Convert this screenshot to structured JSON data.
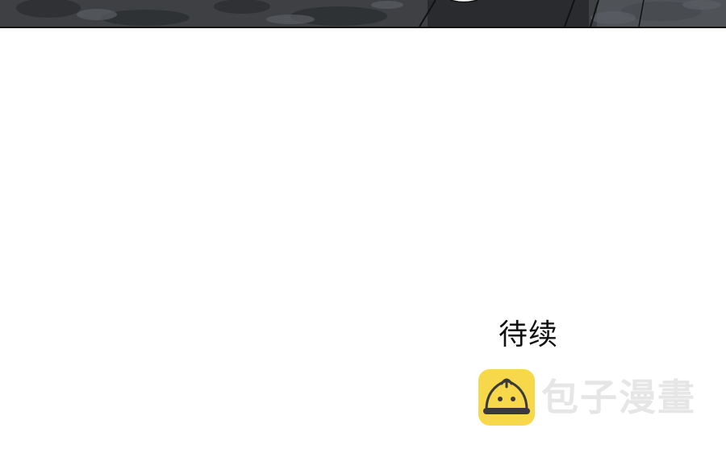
{
  "panel": {
    "caption": "待续"
  },
  "watermark": {
    "icon": "steamed-bun-logo-icon",
    "brand_name": "包子漫畫"
  },
  "colors": {
    "panel_dark": "#3b3d40",
    "logo_yellow": "#f7d84a",
    "watermark_gray": "#e6e6e6",
    "text": "#111111"
  }
}
